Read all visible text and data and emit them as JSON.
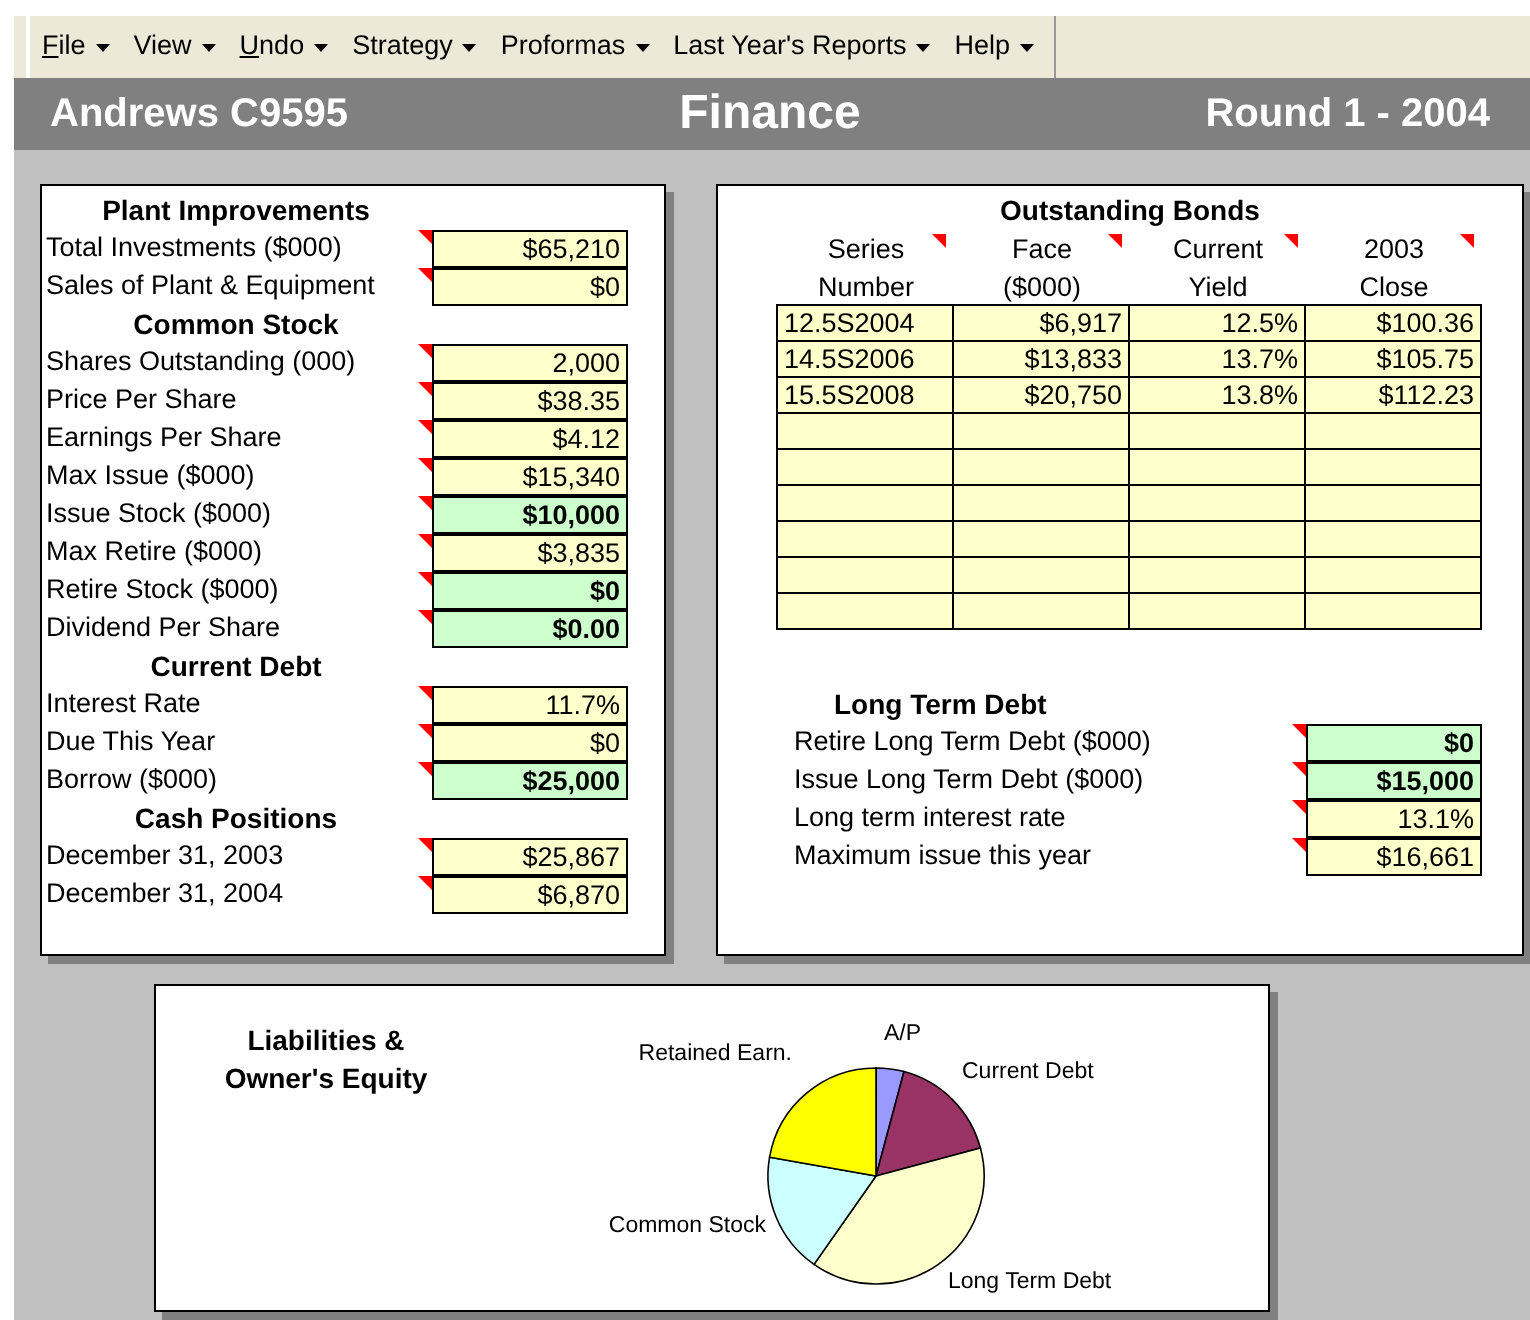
{
  "menu": [
    {
      "label": "File",
      "underline_first": true
    },
    {
      "label": "View",
      "underline_first": false
    },
    {
      "label": "Undo",
      "underline_first": true
    },
    {
      "label": "Strategy",
      "underline_first": false
    },
    {
      "label": "Proformas",
      "underline_first": false
    },
    {
      "label": "Last Year's Reports",
      "underline_first": false
    },
    {
      "label": "Help",
      "underline_first": false
    }
  ],
  "header": {
    "company": "Andrews C9595",
    "title": "Finance",
    "round": "Round 1 - 2004"
  },
  "left_panel": [
    {
      "heading": "Plant Improvements",
      "rows": [
        {
          "label": "Total Investments ($000)",
          "value": "$65,210",
          "kind": "output",
          "note": true
        },
        {
          "label": "Sales of Plant & Equipment",
          "value": "$0",
          "kind": "output",
          "note": true
        }
      ]
    },
    {
      "heading": "Common Stock",
      "rows": [
        {
          "label": "Shares Outstanding (000)",
          "value": "2,000",
          "kind": "output",
          "note": true
        },
        {
          "label": "Price Per Share",
          "value": "$38.35",
          "kind": "output",
          "note": true
        },
        {
          "label": "Earnings Per Share",
          "value": "$4.12",
          "kind": "output",
          "note": true
        },
        {
          "label": "Max Issue ($000)",
          "value": "$15,340",
          "kind": "output",
          "note": true
        },
        {
          "label": "Issue Stock  ($000)",
          "value": "$10,000",
          "kind": "input",
          "note": true
        },
        {
          "label": "Max Retire ($000)",
          "value": "$3,835",
          "kind": "output",
          "note": true
        },
        {
          "label": "Retire Stock ($000)",
          "value": "$0",
          "kind": "input",
          "note": true
        },
        {
          "label": "Dividend Per Share",
          "value": "$0.00",
          "kind": "input",
          "note": true
        }
      ]
    },
    {
      "heading": "Current Debt",
      "rows": [
        {
          "label": "Interest Rate",
          "value": "11.7%",
          "kind": "output",
          "note": true
        },
        {
          "label": "Due This Year",
          "value": "$0",
          "kind": "output",
          "note": true
        },
        {
          "label": "Borrow ($000)",
          "value": "$25,000",
          "kind": "input",
          "note": true
        }
      ]
    },
    {
      "heading": "Cash Positions",
      "rows": [
        {
          "label": "December 31, 2003",
          "value": "$25,867",
          "kind": "output",
          "note": true
        },
        {
          "label": "December 31, 2004",
          "value": "$6,870",
          "kind": "output",
          "note": true
        }
      ]
    }
  ],
  "bonds": {
    "title": "Outstanding Bonds",
    "columns": [
      {
        "line1": "Series",
        "line2": "Number",
        "note": true
      },
      {
        "line1": "Face",
        "line2": "($000)",
        "note": true
      },
      {
        "line1": "Current",
        "line2": "Yield",
        "note": true
      },
      {
        "line1": "2003",
        "line2": "Close",
        "note": true
      }
    ],
    "rows": [
      [
        "12.5S2004",
        "$6,917",
        "12.5%",
        "$100.36"
      ],
      [
        "14.5S2006",
        "$13,833",
        "13.7%",
        "$105.75"
      ],
      [
        "15.5S2008",
        "$20,750",
        "13.8%",
        "$112.23"
      ]
    ]
  },
  "long_term_debt": {
    "heading": "Long Term Debt",
    "rows": [
      {
        "label": "Retire Long Term Debt ($000)",
        "value": "$0",
        "kind": "input",
        "note": true
      },
      {
        "label": "Issue  Long Term Debt ($000)",
        "value": "$15,000",
        "kind": "input",
        "note": true
      },
      {
        "label": "Long term interest rate",
        "value": "13.1%",
        "kind": "output",
        "note": true
      },
      {
        "label": "Maximum issue this year",
        "value": "$16,661",
        "kind": "output",
        "note": true
      }
    ]
  },
  "pie_chart": {
    "title_line1": "Liabilities &",
    "title_line2": "Owner's Equity",
    "slices": [
      {
        "label": "A/P",
        "color": "#9999ff"
      },
      {
        "label": "Current Debt",
        "color": "#993366"
      },
      {
        "label": "Long Term Debt",
        "color": "#ffffcc"
      },
      {
        "label": "Common Stock",
        "color": "#ccffff"
      },
      {
        "label": "Retained Earn.",
        "color": "#ffff00"
      }
    ]
  }
}
